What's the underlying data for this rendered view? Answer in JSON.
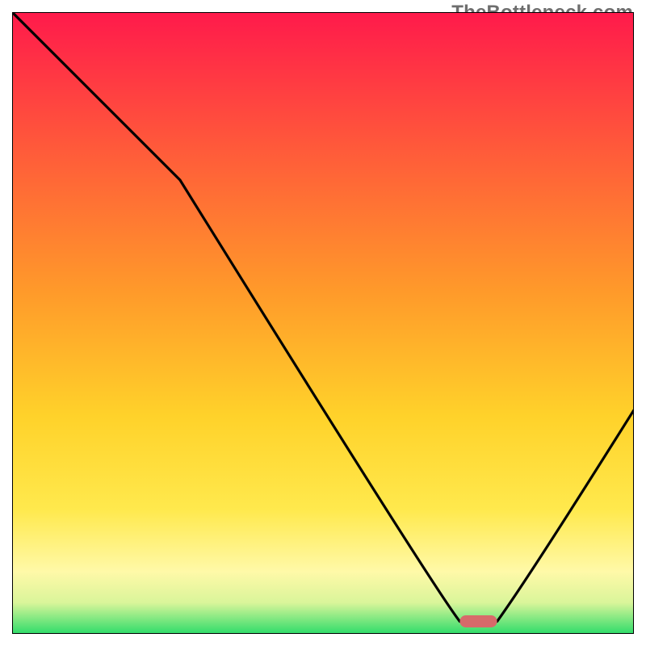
{
  "watermark": "TheBottleneck.com",
  "chart_data": {
    "type": "line",
    "title": "",
    "xlabel": "",
    "ylabel": "",
    "xlim": [
      0,
      100
    ],
    "ylim": [
      0,
      100
    ],
    "grid": false,
    "legend": false,
    "series": [
      {
        "name": "bottleneck-curve",
        "x": [
          0,
          27,
          72,
          78,
          100
        ],
        "y": [
          100,
          73,
          2,
          2,
          36
        ],
        "color": "#000000"
      }
    ],
    "marker": {
      "name": "optimal-range",
      "x_start": 72,
      "x_end": 78,
      "y": 2,
      "color": "#d76a6a"
    },
    "background_gradient": {
      "top": "#ff1a4b",
      "mid1": "#ff9a2a",
      "mid2": "#ffe633",
      "mid3": "#fff9a8",
      "bottom": "#2fdc6a"
    }
  }
}
